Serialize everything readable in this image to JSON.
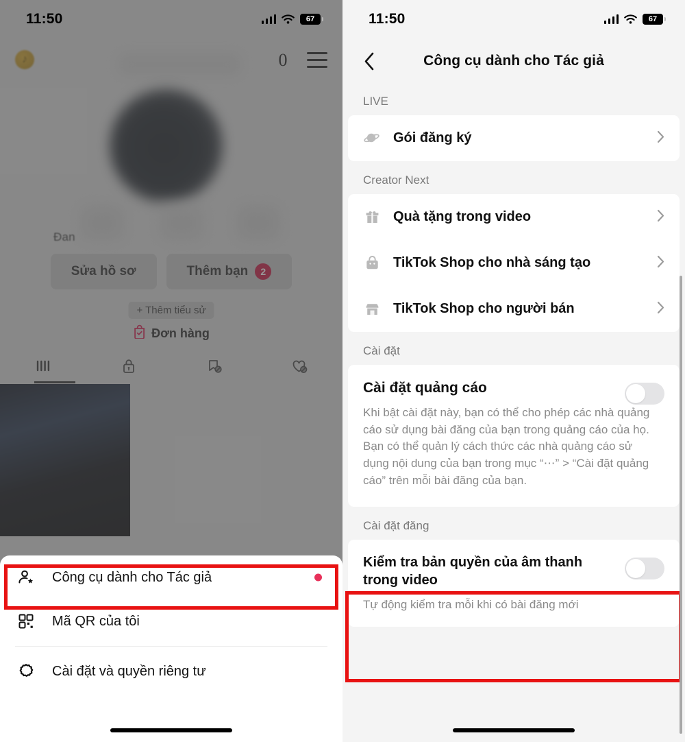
{
  "status_bar": {
    "time": "11:50",
    "battery": "67",
    "signal_icon": "cellular-signal-icon",
    "wifi_icon": "wifi-icon"
  },
  "left_screen": {
    "top_bar": {
      "coin_icon": "tiktok-coin-icon",
      "live_icon": "live-badge-icon",
      "menu_icon": "hamburger-menu-icon"
    },
    "profile": {
      "stats_label": "Đan",
      "edit_profile_label": "Sửa hồ sơ",
      "add_friends_label": "Thêm bạn",
      "add_friends_badge": "2",
      "add_bio_label": "+ Thêm tiểu sử",
      "orders_label": "Đơn hàng",
      "orders_icon": "shopping-bag-check-icon",
      "tabs": [
        {
          "icon": "grid-posts-icon",
          "active": true
        },
        {
          "icon": "lock-private-icon",
          "active": false
        },
        {
          "icon": "bookmark-hidden-icon",
          "active": false
        },
        {
          "icon": "heart-hidden-icon",
          "active": false
        }
      ]
    },
    "action_sheet": {
      "items": [
        {
          "icon": "person-star-icon",
          "label": "Công cụ dành cho Tác giả",
          "badge_dot": true,
          "highlighted": true
        },
        {
          "icon": "qr-code-icon",
          "label": "Mã QR của tôi",
          "badge_dot": false,
          "highlighted": false
        },
        {
          "icon": "gear-settings-icon",
          "label": "Cài đặt và quyền riêng tư",
          "badge_dot": false,
          "highlighted": false
        }
      ]
    }
  },
  "right_screen": {
    "nav": {
      "back_icon": "chevron-left-icon",
      "title": "Công cụ dành cho Tác giả"
    },
    "sections": [
      {
        "label": "LIVE",
        "rows": [
          {
            "icon": "subscription-planet-icon",
            "label": "Gói đăng ký",
            "chevron": "chevron-right-icon"
          }
        ]
      },
      {
        "label": "Creator Next",
        "rows": [
          {
            "icon": "gift-icon",
            "label": "Quà tặng trong video",
            "chevron": "chevron-right-icon"
          },
          {
            "icon": "shopping-bag-icon",
            "label": "TikTok Shop cho nhà sáng tạo",
            "chevron": "chevron-right-icon"
          },
          {
            "icon": "storefront-icon",
            "label": "TikTok Shop cho người bán",
            "chevron": "chevron-right-icon"
          }
        ]
      }
    ],
    "settings_section": {
      "label": "Cài đặt",
      "ad_setting": {
        "title": "Cài đặt quảng cáo",
        "description": "Khi bật cài đặt này, bạn có thể cho phép các nhà quảng cáo sử dụng bài đăng của bạn trong quảng cáo của họ. Bạn có thể quản lý cách thức các nhà quảng cáo sử dụng nội dung của bạn trong mục “⋯” > “Cài đặt quảng cáo” trên mỗi bài đăng của bạn.",
        "toggle_state": "off"
      }
    },
    "post_section": {
      "label": "Cài đặt đăng",
      "copyright_check": {
        "title": "Kiểm tra bản quyền của âm thanh trong video",
        "subtitle": "Tự động kiểm tra mỗi khi có bài đăng mới",
        "toggle_state": "off",
        "highlighted": true
      }
    }
  },
  "colors": {
    "highlight_box": "#e81212",
    "badge_red": "#c5123d",
    "dot_red": "#e8315a",
    "toggle_off_track": "#e4e4e6"
  }
}
